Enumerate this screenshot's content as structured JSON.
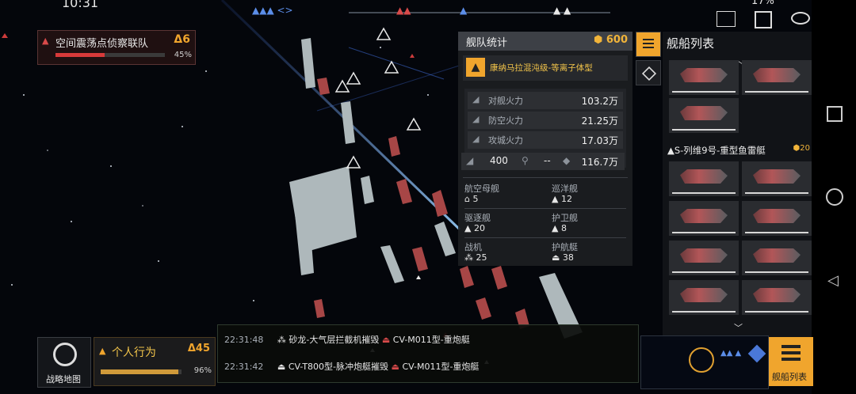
{
  "status_bar": {
    "time": "10:31",
    "battery": "17%"
  },
  "objective": {
    "title": "空间震荡点侦察联队",
    "level": "6",
    "progress_label": "45%",
    "progress_fraction": 0.45
  },
  "fleet_stats": {
    "title": "舰队统计",
    "cost": "600",
    "formation_name": "康纳马拉混沌级-等离子体型",
    "power": [
      {
        "label": "对舰火力",
        "value": "103.2万"
      },
      {
        "label": "防空火力",
        "value": "21.25万"
      },
      {
        "label": "攻城火力",
        "value": "17.03万"
      }
    ],
    "summary": {
      "a": "400",
      "b": "--",
      "c": "116.7万"
    },
    "classes": [
      {
        "label": "航空母舰",
        "count": "5"
      },
      {
        "label": "巡洋舰",
        "count": "12"
      },
      {
        "label": "驱逐舰",
        "count": "20"
      },
      {
        "label": "护卫舰",
        "count": "8"
      },
      {
        "label": "战机",
        "count": "25"
      },
      {
        "label": "护航艇",
        "count": "38"
      }
    ]
  },
  "ship_list": {
    "title": "舰船列表",
    "group_name": "S-列维9号-重型鱼雷艇",
    "group_cost": "20"
  },
  "strategy_map": {
    "label": "战略地图"
  },
  "personal_action": {
    "title": "个人行为",
    "level": "45",
    "progress_label": "96%",
    "progress_fraction": 0.96
  },
  "combat_log": [
    {
      "time": "22:31:48",
      "attacker": "砂龙-大气层拦截机摧毁",
      "target": "CV-M011型-重炮艇"
    },
    {
      "time": "22:31:42",
      "attacker": "CV-T800型-脉冲炮艇摧毁",
      "target": "CV-M011型-重炮艇"
    }
  ],
  "ship_list_button": {
    "label": "舰船列表"
  },
  "colors": {
    "accent": "#f0a52d",
    "danger": "#d83a3a"
  }
}
